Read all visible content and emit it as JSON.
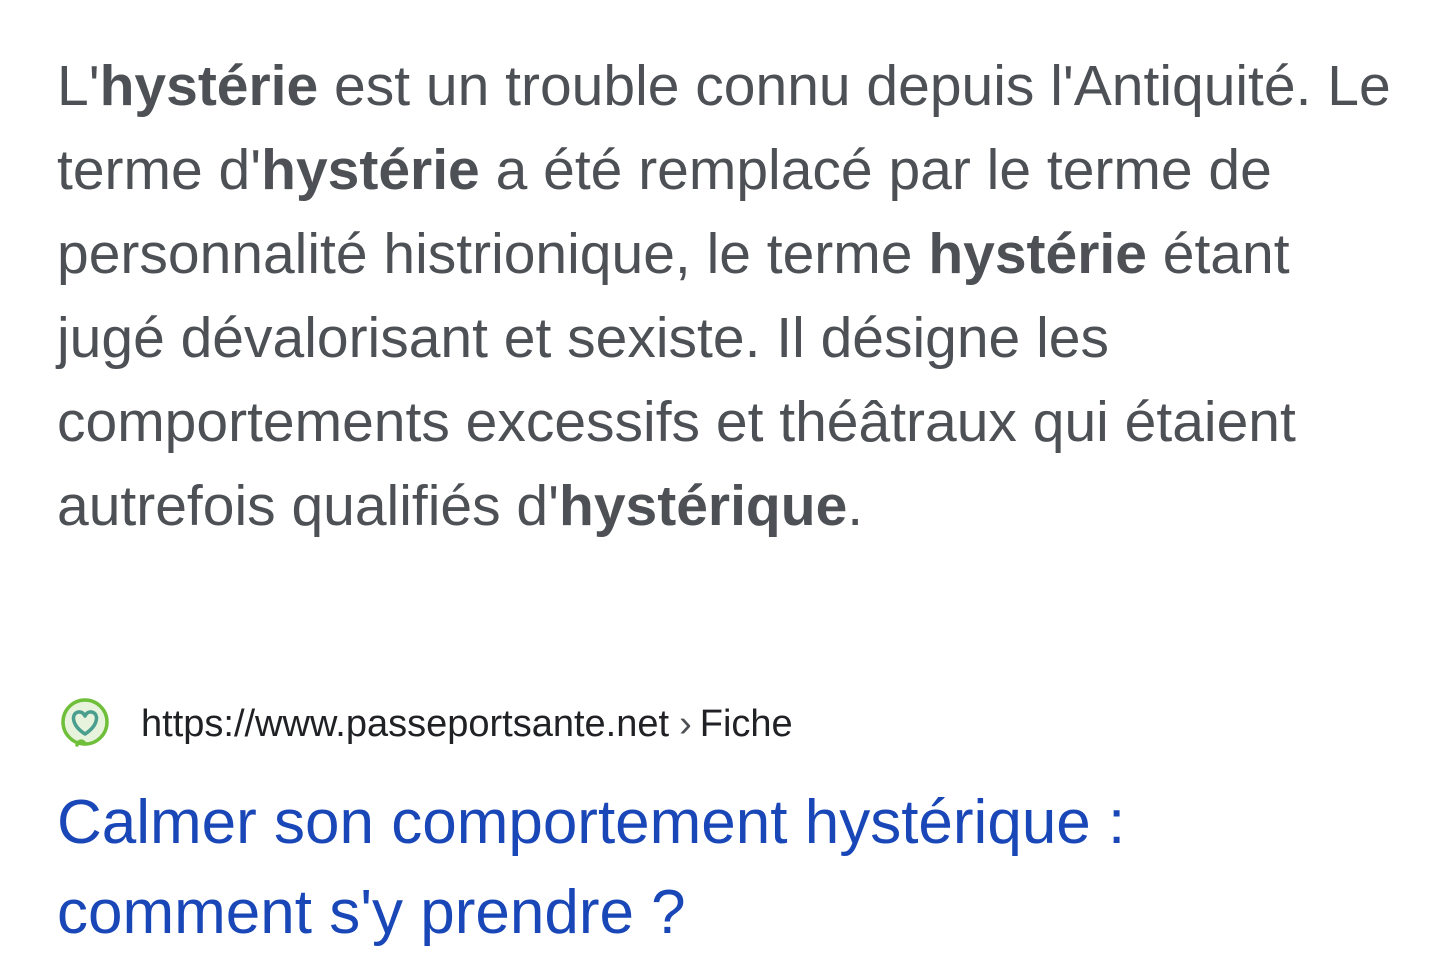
{
  "snippet": {
    "segments": [
      {
        "text": "L'",
        "bold": false
      },
      {
        "text": "hystérie",
        "bold": true
      },
      {
        "text": " est un trouble connu depuis l'Antiquité. Le terme d'",
        "bold": false
      },
      {
        "text": "hystérie",
        "bold": true
      },
      {
        "text": " a été remplacé par le terme de personnalité histrionique, le terme ",
        "bold": false
      },
      {
        "text": "hystérie",
        "bold": true
      },
      {
        "text": " étant jugé dévalorisant et sexiste. Il désigne les comportements excessifs et théâtraux qui étaient autrefois qualifiés d'",
        "bold": false
      },
      {
        "text": "hystérique",
        "bold": true
      },
      {
        "text": ".",
        "bold": false
      }
    ]
  },
  "result": {
    "favicon_icon": "heart-leaf-icon",
    "url": "https://www.passeportsante.net",
    "separator": "›",
    "breadcrumb": "Fiche",
    "title": "Calmer son comportement hystérique : comment s'y prendre ?"
  },
  "colors": {
    "snippet_text": "#4d5156",
    "url_text": "#202124",
    "title_link": "#1a47b8",
    "favicon_green": "#6fbf3a",
    "favicon_teal": "#4a9e8e"
  }
}
